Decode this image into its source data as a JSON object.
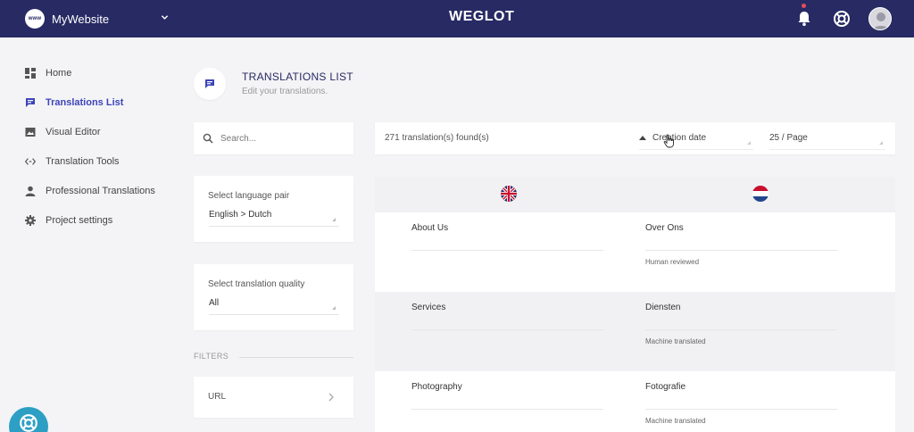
{
  "topbar": {
    "site_badge": "www",
    "site_name": "MyWebsite",
    "brand": "WEGLOT",
    "icons": [
      "bell-icon",
      "help-lifebuoy-icon",
      "user-avatar"
    ],
    "colors": {
      "bar": "#272a63",
      "notification_dot": "#e84a5f"
    }
  },
  "sidebar": {
    "items": [
      {
        "label": "Home",
        "icon": "grid-icon"
      },
      {
        "label": "Translations List",
        "icon": "translations-icon",
        "active": true
      },
      {
        "label": "Visual Editor",
        "icon": "image-icon"
      },
      {
        "label": "Translation Tools",
        "icon": "code-icon"
      },
      {
        "label": "Professional Translations",
        "icon": "person-icon"
      },
      {
        "label": "Project settings",
        "icon": "gear-icon"
      }
    ],
    "active_color": "#3d44b8"
  },
  "header": {
    "title": "TRANSLATIONS LIST",
    "subtitle": "Edit your translations."
  },
  "search": {
    "placeholder": "Search..."
  },
  "language_pair": {
    "label": "Select language pair",
    "value": "English > Dutch"
  },
  "quality": {
    "label": "Select translation quality",
    "value": "All"
  },
  "filters": {
    "label": "FILTERS",
    "url_label": "URL"
  },
  "results": {
    "count_text": "271 translation(s) found(s)",
    "sort_label": "Creation date",
    "page_size": "25 / Page"
  },
  "table": {
    "source_flag": "uk-flag-icon",
    "target_flag": "netherlands-flag-icon",
    "rows": [
      {
        "source": "About Us",
        "target": "Over Ons",
        "status": "Human reviewed"
      },
      {
        "source": "Services",
        "target": "Diensten",
        "status": "Machine translated"
      },
      {
        "source": "Photography",
        "target": "Fotografie",
        "status": "Machine translated"
      }
    ]
  },
  "floating_help": {
    "icon": "help-lifebuoy-icon",
    "color": "#2d9fc4"
  }
}
